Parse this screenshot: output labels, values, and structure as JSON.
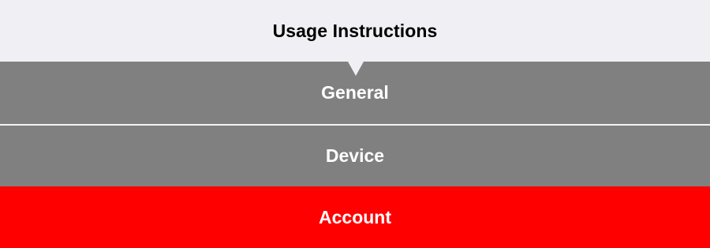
{
  "header": {
    "title": "Usage Instructions"
  },
  "menu": {
    "items": [
      {
        "label": "General",
        "color": "#808080"
      },
      {
        "label": "Device",
        "color": "#808080"
      },
      {
        "label": "Account",
        "color": "#ff0000"
      }
    ]
  },
  "colors": {
    "header_bg": "#efeff4",
    "item_bg": "#808080",
    "active_bg": "#ff0000",
    "text_on_item": "#ffffff"
  },
  "icons": {
    "pointer": "caret-down-icon"
  }
}
